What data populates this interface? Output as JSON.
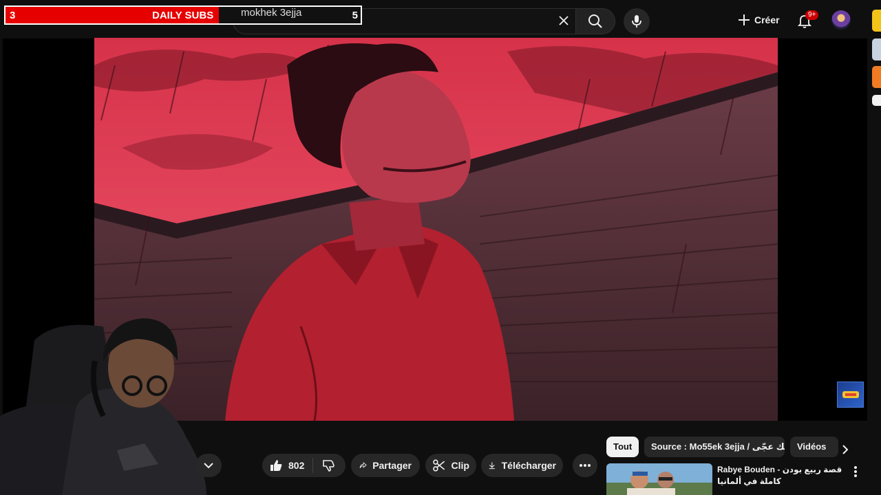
{
  "overlay": {
    "left_count": "3",
    "title": "DAILY SUBS",
    "right_count": "5",
    "progress_fraction": 0.6
  },
  "search": {
    "value": "mokhek 3ejja",
    "clear_icon": "close-icon",
    "search_icon": "search-icon",
    "mic_icon": "microphone-icon"
  },
  "header": {
    "create_label": "Créer",
    "notifications_badge": "9+"
  },
  "actions": {
    "like_count": "802",
    "share_label": "Partager",
    "clip_label": "Clip",
    "download_label": "Télécharger"
  },
  "chips": [
    {
      "label": "Tout",
      "active": true
    },
    {
      "label": "Source : Mo55ek 3ejja / مخّك عجّى"
    },
    {
      "label": "Vidéos"
    }
  ],
  "recommendation": {
    "title": "Rabye Bouden - قصة ربيع بودن كاملة في ألمانيا"
  },
  "colors": {
    "overlay_fill": "#e60000",
    "notification_badge": "#cc0000",
    "active_chip": "#f1f1f1"
  }
}
